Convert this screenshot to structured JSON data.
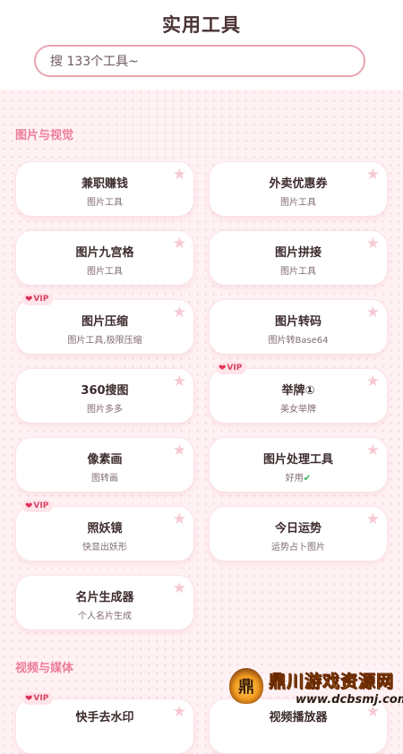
{
  "header": {
    "title": "实用工具",
    "search_placeholder": "搜 133个工具~"
  },
  "sections": [
    {
      "title": "图片与视觉",
      "cards": [
        {
          "name": "兼职赚钱",
          "sub": "图片工具",
          "vip": false
        },
        {
          "name": "外卖优惠券",
          "sub": "图片工具",
          "vip": false
        },
        {
          "name": "图片九宫格",
          "sub": "图片工具",
          "vip": false
        },
        {
          "name": "图片拼接",
          "sub": "图片工具",
          "vip": false
        },
        {
          "name": "图片压缩",
          "sub": "图片工具,极限压缩",
          "vip": true
        },
        {
          "name": "图片转码",
          "sub": "图片转Base64",
          "vip": false
        },
        {
          "name": "360搜图",
          "sub": "图片多多",
          "vip": false
        },
        {
          "name": "举牌①",
          "sub": "美女举牌",
          "vip": true
        },
        {
          "name": "像素画",
          "sub": "图转画",
          "vip": false
        },
        {
          "name": "图片处理工具",
          "sub": "好用",
          "vip": false
        },
        {
          "name": "照妖镜",
          "sub": "快显出妖形",
          "vip": true
        },
        {
          "name": "今日运势",
          "sub": "运势占卜图片",
          "vip": false
        },
        {
          "name": "名片生成器",
          "sub": "个人名片生成",
          "vip": false
        }
      ]
    },
    {
      "title": "视频与媒体",
      "cards": [
        {
          "name": "快手去水印",
          "sub": "",
          "vip": true
        },
        {
          "name": "视频播放器",
          "sub": "",
          "vip": false
        }
      ]
    }
  ],
  "vip_label": "VIP",
  "star_glyph": "★",
  "heart_glyph": "❤",
  "check_glyph": "✔",
  "watermark": {
    "logo_char": "鼎",
    "text": "鼎川游戏资源网",
    "url": "www.dcbsmj.com"
  },
  "colors": {
    "accent_pink": "#ee7d9a",
    "star": "#f7c9d3",
    "vip_text": "#d74463",
    "check_green": "#2db354"
  }
}
